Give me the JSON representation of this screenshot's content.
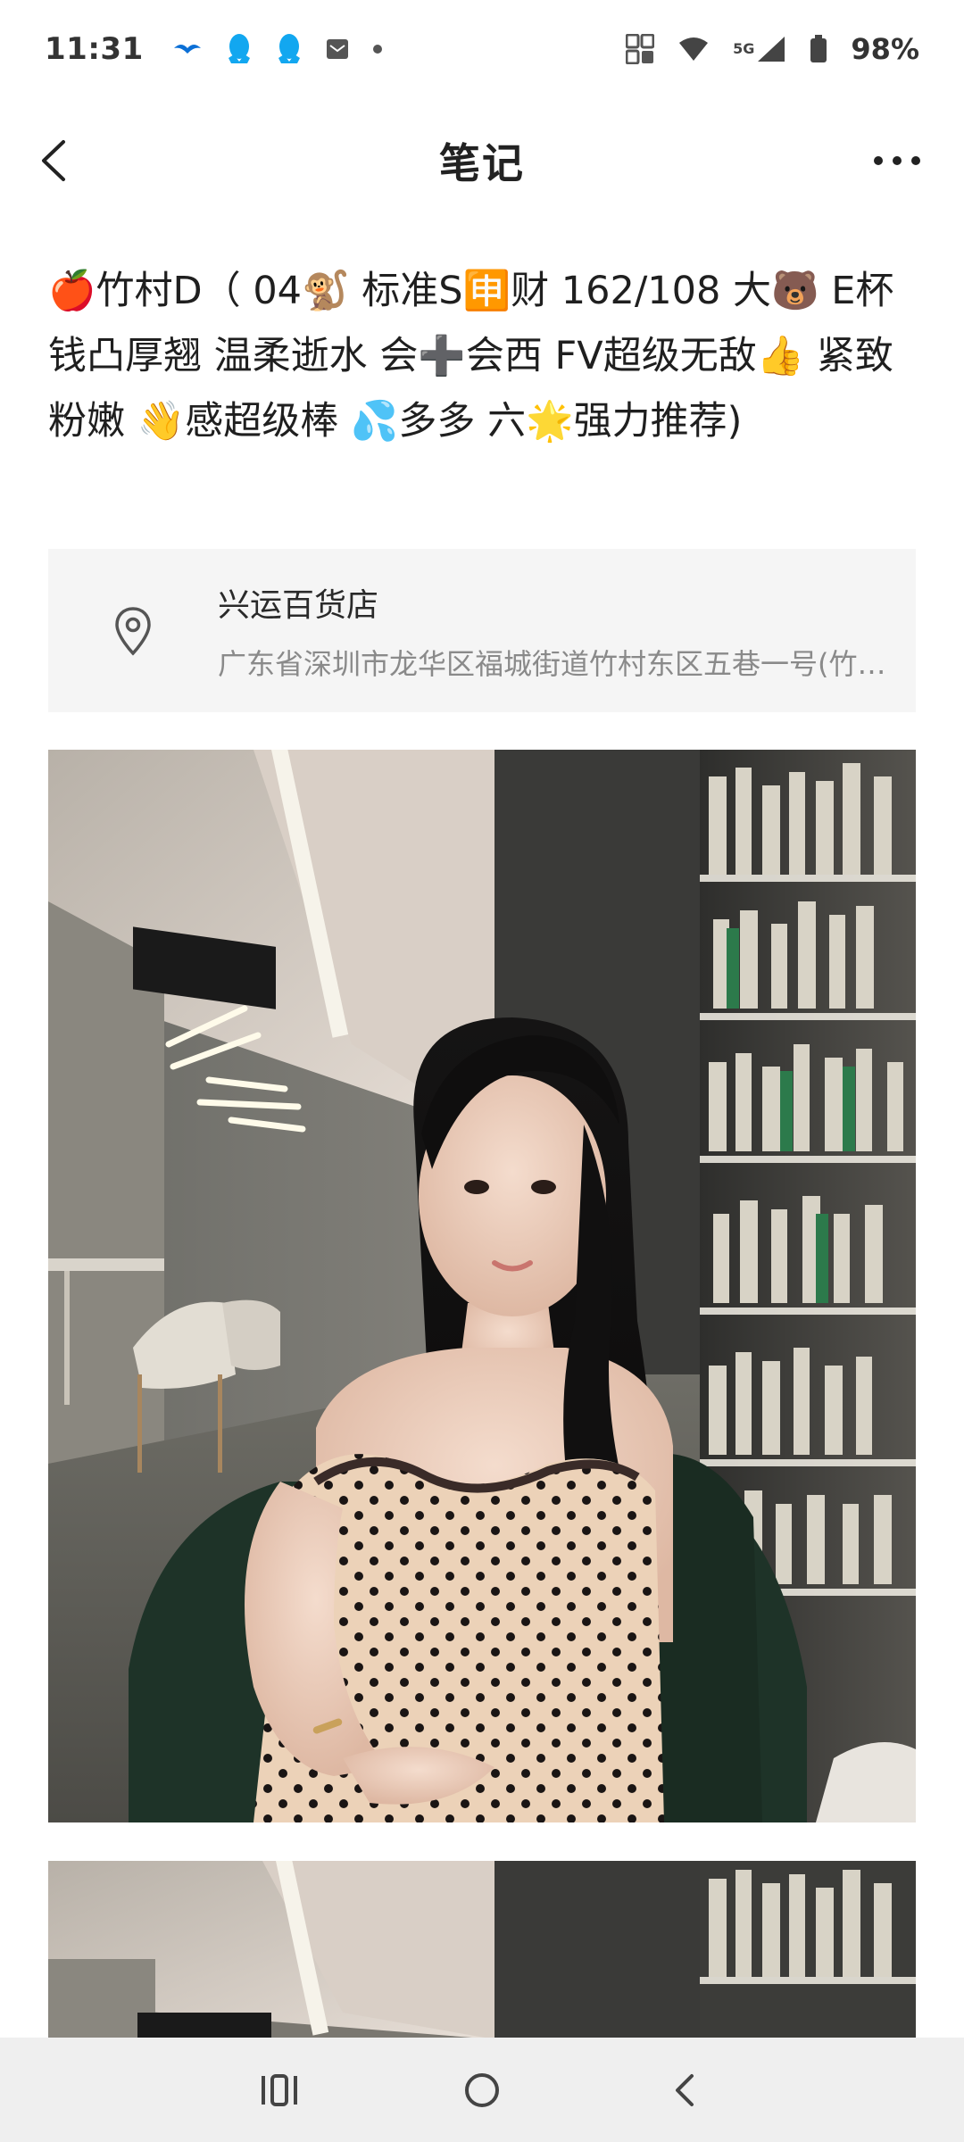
{
  "status_bar": {
    "time": "11:31",
    "network": "5G",
    "battery": "98%",
    "icons": [
      "bird-icon",
      "qq-icon",
      "qq-icon",
      "mail-icon",
      "dot-icon",
      "nfc-icon",
      "wifi-icon",
      "signal-icon",
      "battery-icon"
    ]
  },
  "header": {
    "title": "笔记",
    "back_icon": "chevron-left-icon",
    "more_icon": "more-icon"
  },
  "note": {
    "text": "🍎竹村D（ 04🐒 标准S🈸财 162/108 大🐻 E杯 钱凸厚翘  温柔逝水 会➕会西 FV超级无敌👍 紧致粉嫩 👋感超级棒 💦多多 六🌟强力推荐)"
  },
  "location": {
    "name": "兴运百货店",
    "address": "广东省深圳市龙华区福城街道竹村东区五巷一号(竹村东区五巷一号)",
    "icon": "location-pin-icon"
  },
  "images": [
    {
      "alt": "photo-1"
    },
    {
      "alt": "photo-2"
    }
  ],
  "system_nav": {
    "icons": [
      "recent-apps-icon",
      "home-icon",
      "back-icon"
    ]
  }
}
